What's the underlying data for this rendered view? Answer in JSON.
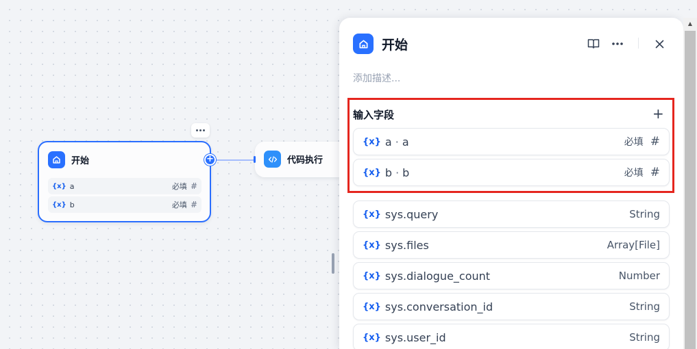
{
  "canvas": {
    "start_node": {
      "title": "开始",
      "variables": [
        {
          "name": "a",
          "required": "必填"
        },
        {
          "name": "b",
          "required": "必填"
        }
      ]
    },
    "code_node": {
      "title": "代码执行"
    }
  },
  "panel": {
    "title": "开始",
    "description_placeholder": "添加描述...",
    "input_section": {
      "title": "输入字段",
      "fields": [
        {
          "name": "a",
          "label": "a",
          "required": "必填"
        },
        {
          "name": "b",
          "label": "b",
          "required": "必填"
        }
      ]
    },
    "system_variables": [
      {
        "name": "sys.query",
        "type": "String"
      },
      {
        "name": "sys.files",
        "type": "Array[File]"
      },
      {
        "name": "sys.dialogue_count",
        "type": "Number"
      },
      {
        "name": "sys.conversation_id",
        "type": "String"
      },
      {
        "name": "sys.user_id",
        "type": "String"
      }
    ]
  },
  "colors": {
    "accent": "#2970ff",
    "highlight": "#e5261e",
    "canvas_bg": "#f2f4f7"
  }
}
